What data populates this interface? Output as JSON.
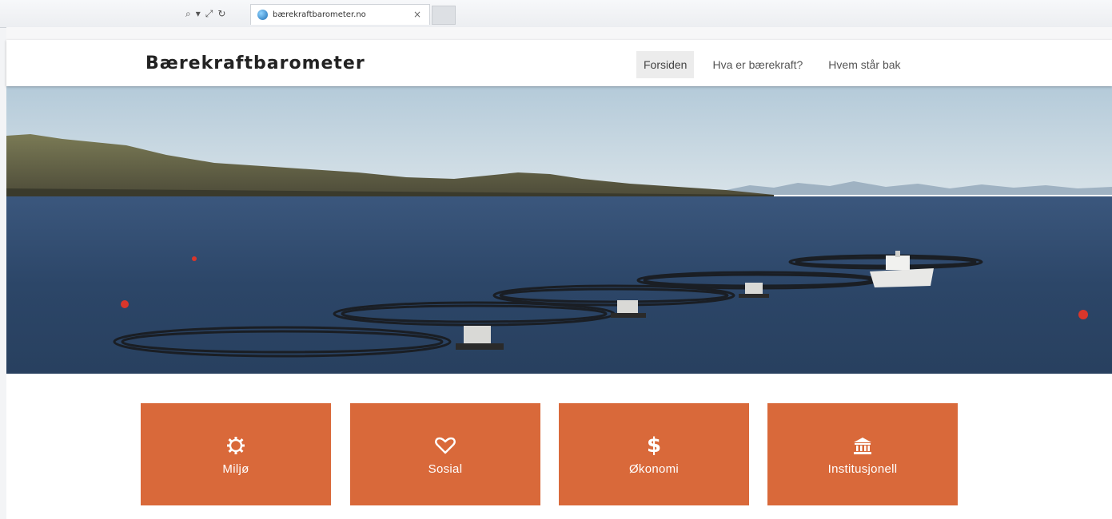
{
  "browser": {
    "tab_title": "bærekraftbarometer.no",
    "tab_close": "×",
    "address_controls": [
      "⌕",
      "▾",
      "⤢",
      "↻"
    ]
  },
  "site": {
    "brand": "Bærekraftbarometer",
    "nav": [
      {
        "label": "Forsiden",
        "active": true
      },
      {
        "label": "Hva er bærekraft?",
        "active": false
      },
      {
        "label": "Hvem står bak",
        "active": false
      }
    ]
  },
  "hero": {
    "image": "fish-farm-pens-in-fjord"
  },
  "cards": [
    {
      "label": "Miljø",
      "icon": "gear-icon"
    },
    {
      "label": "Sosial",
      "icon": "heart-icon"
    },
    {
      "label": "Økonomi",
      "icon": "dollar-icon",
      "glyph": "$"
    },
    {
      "label": "Institusjonell",
      "icon": "bank-icon"
    }
  ],
  "colors": {
    "card_background": "#d9693a",
    "sea": "#2f4a6e",
    "sky": "#bcd2e0"
  }
}
